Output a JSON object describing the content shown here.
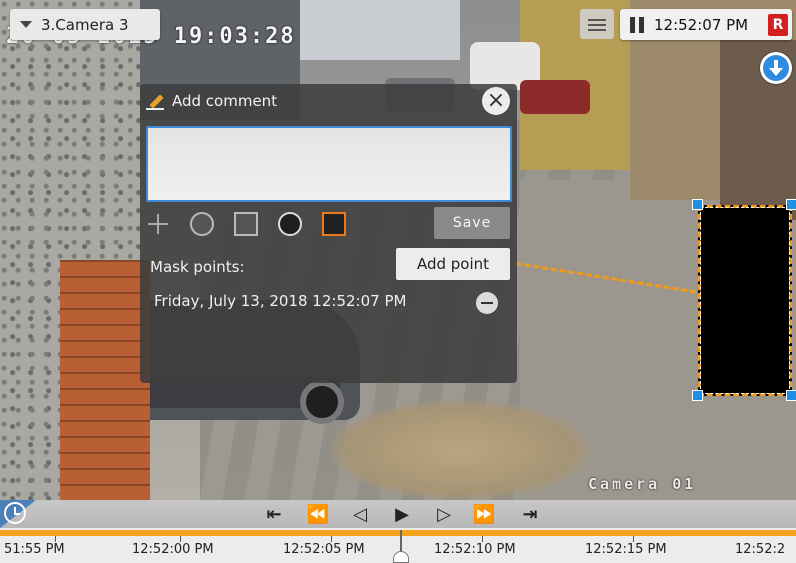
{
  "feed": {
    "timestamp_overlay": "20-05-2015 19:03:28",
    "camera_overlay": "Camera 01"
  },
  "top_bar": {
    "camera_name": "3.Camera 3",
    "time": "12:52:07 PM",
    "rec_badge": "R"
  },
  "comment_panel": {
    "title": "Add comment",
    "close_glyph": "×",
    "comment_value": "",
    "save_label": "Save",
    "mask_points_label": "Mask points:",
    "add_point_label": "Add point",
    "points": [
      "Friday, July 13, 2018 12:52:07 PM"
    ]
  },
  "controls": {
    "begin": "⇤",
    "fast_back": "⏪",
    "step_back": "◁",
    "play": "▶",
    "step_fwd": "▷",
    "fast_fwd": "⏩",
    "end": "⇥"
  },
  "timeline": {
    "labels": [
      "51:55 PM",
      "12:52:00 PM",
      "12:52:05 PM",
      "12:52:10 PM",
      "12:52:15 PM",
      "12:52:2"
    ]
  },
  "colors": {
    "accent_blue": "#1f8fe5",
    "mask_dash": "#f29a1a",
    "rec_red": "#d21f1f",
    "timeline_track": "#f3a21a"
  },
  "icons": {
    "camera_dropdown": "chevron-down-icon",
    "pause": "pause-icon",
    "download": "download-icon",
    "comment": "pencil-icon",
    "close": "close-icon",
    "clock": "clock-icon",
    "remove_point": "minus-circle-icon"
  }
}
